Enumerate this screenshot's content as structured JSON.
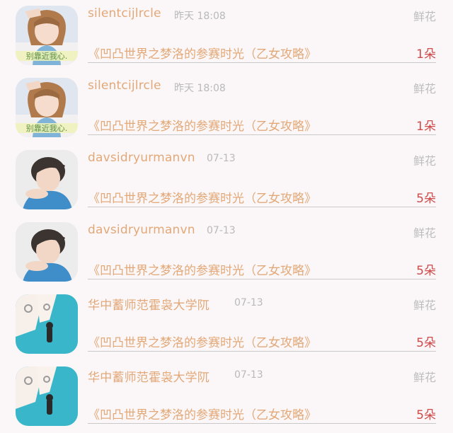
{
  "items": [
    {
      "user": "silentcijlrcle",
      "time": "昨天 18:08",
      "gift": "鲜花",
      "title": "《凹凸世界之梦洛的参赛时光（乙女攻略》",
      "count": "1朵",
      "avatar": "girl-sign-photo",
      "sign_text": "别靠近我心."
    },
    {
      "user": "silentcijlrcle",
      "time": "昨天 18:08",
      "gift": "鲜花",
      "title": "《凹凸世界之梦洛的参赛时光（乙女攻略》",
      "count": "1朵",
      "avatar": "girl-sign-photo",
      "sign_text": "别靠近我心."
    },
    {
      "user": "davsidryurmanvn",
      "time": "07-13",
      "gift": "鲜花",
      "title": "《凹凸世界之梦洛的参赛时光（乙女攻略》",
      "count": "5朵",
      "avatar": "boy-photo"
    },
    {
      "user": "davsidryurmanvn",
      "time": "07-13",
      "gift": "鲜花",
      "title": "《凹凸世界之梦洛的参赛时光（乙女攻略》",
      "count": "5朵",
      "avatar": "boy-photo"
    },
    {
      "user": "华中蓄师范霍袅大学阢",
      "time": "07-13",
      "gift": "鲜花",
      "title": "《凹凸世界之梦洛的参赛时光（乙女攻略》",
      "count": "5朵",
      "avatar": "hands-art"
    },
    {
      "user": "华中蓄师范霍袅大学阢",
      "time": "07-13",
      "gift": "鲜花",
      "title": "《凹凸世界之梦洛的参赛时光（乙女攻略》",
      "count": "5朵",
      "avatar": "hands-art"
    }
  ],
  "colors": {
    "accent": "#e3a878",
    "count": "#cf4a4a",
    "muted": "#bdbdbd",
    "background": "#fbf7f8"
  }
}
